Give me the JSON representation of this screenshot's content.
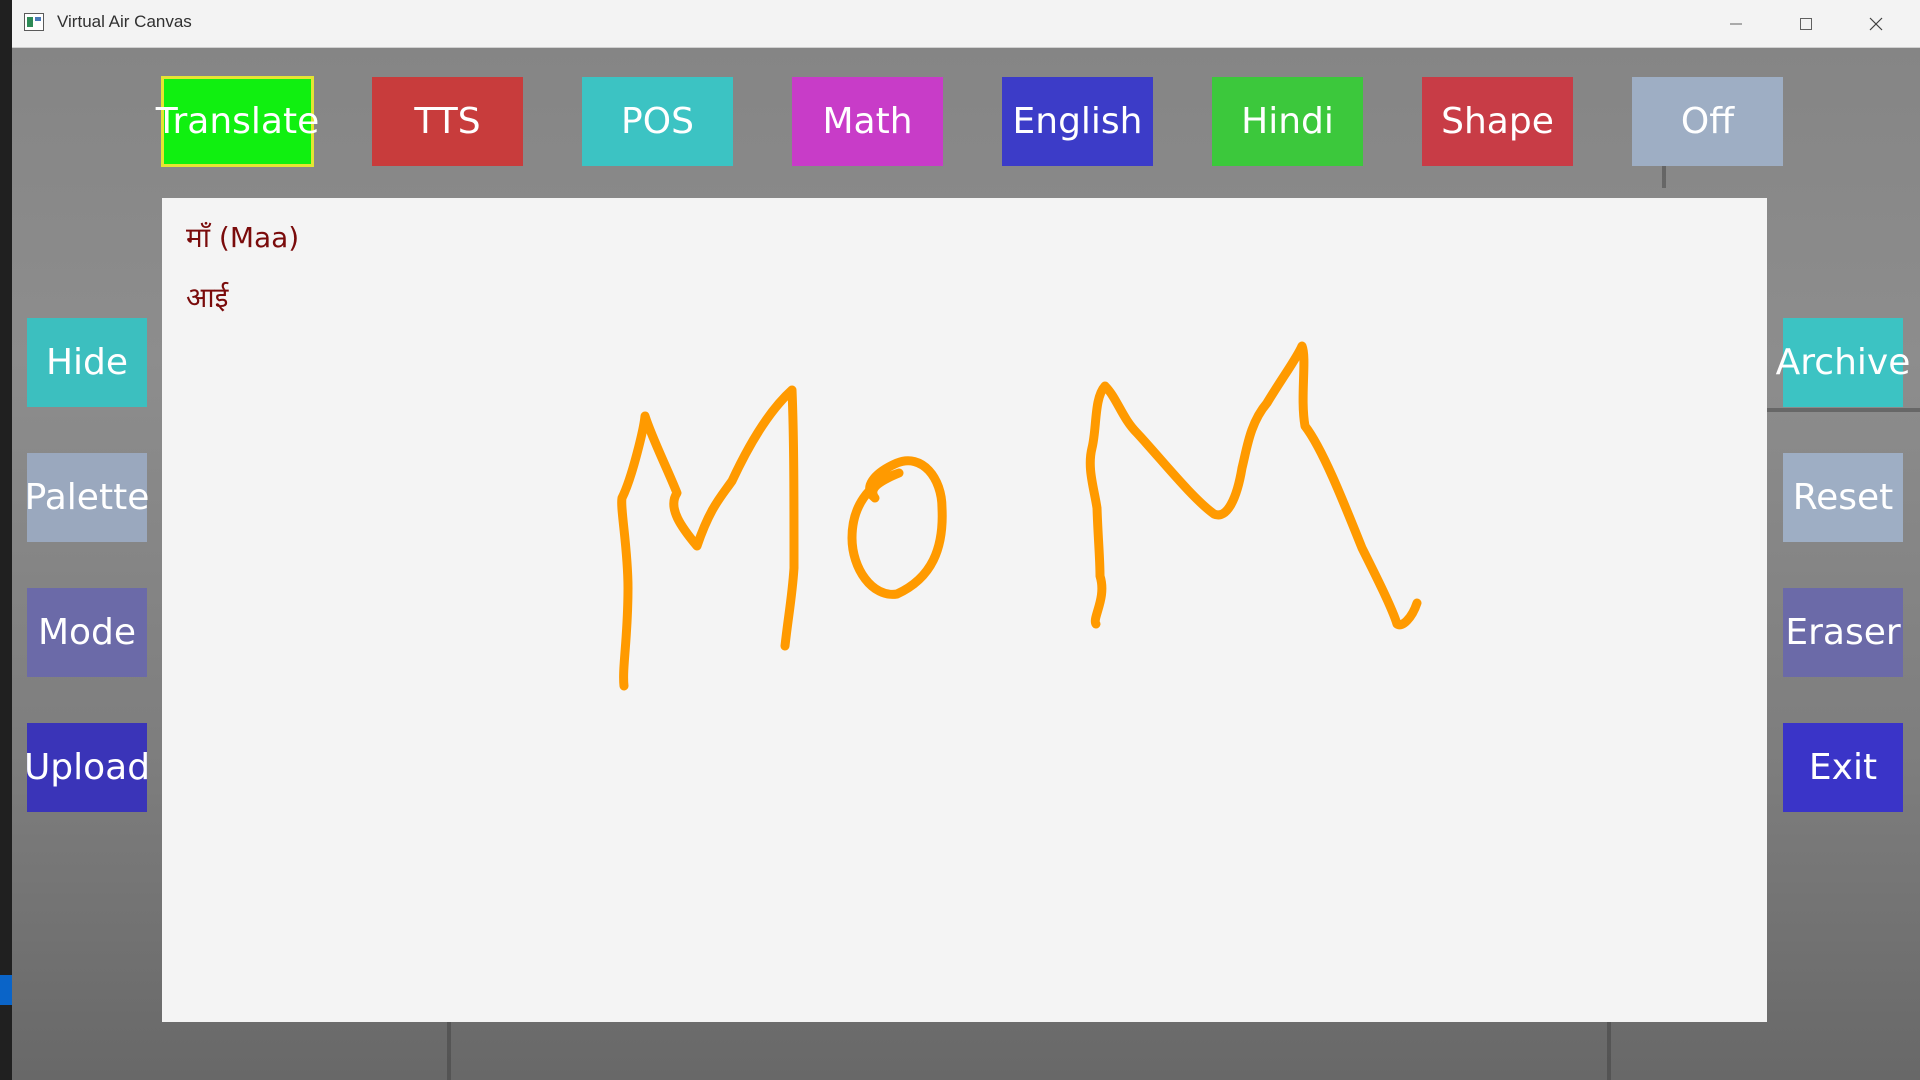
{
  "window": {
    "title": "Virtual Air Canvas",
    "controls": {
      "minimize": "—",
      "maximize": "☐",
      "close": "✕"
    }
  },
  "top_buttons": [
    {
      "label": "Translate",
      "color": "#10f010",
      "selected": true
    },
    {
      "label": "TTS",
      "color": "#c83c3c"
    },
    {
      "label": "POS",
      "color": "#3cc3c3"
    },
    {
      "label": "Math",
      "color": "#c83cc8"
    },
    {
      "label": "English",
      "color": "#3c3cc8"
    },
    {
      "label": "Hindi",
      "color": "#3cc83c"
    },
    {
      "label": "Shape",
      "color": "#c83c46"
    },
    {
      "label": "Off",
      "color": "#9eaec4"
    }
  ],
  "left_buttons": [
    {
      "label": "Hide",
      "color": "#3cbfbf"
    },
    {
      "label": "Palette",
      "color": "#9aa8be"
    },
    {
      "label": "Mode",
      "color": "#6b6aa8"
    },
    {
      "label": "Upload",
      "color": "#3a34b8"
    }
  ],
  "right_buttons": [
    {
      "label": "Archive",
      "color": "#3cc3c3"
    },
    {
      "label": "Reset",
      "color": "#9eaec4"
    },
    {
      "label": "Eraser",
      "color": "#6b6aa8"
    },
    {
      "label": "Exit",
      "color": "#3a34c8"
    }
  ],
  "canvas": {
    "results": [
      "माँ (Maa)",
      "आई"
    ],
    "ink_color": "#ff9a00",
    "ink_text": "MOM"
  }
}
